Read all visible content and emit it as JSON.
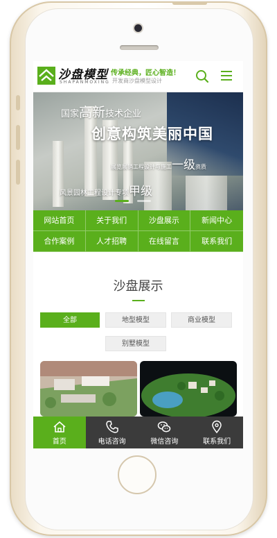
{
  "header": {
    "logo_text": "沙盘模型",
    "logo_sub": "SHAPANMOXING",
    "slogan": "传承经典，匠心智造！",
    "slogan_sub": "开发商沙盘模型设计"
  },
  "banner": {
    "line1_pre": "国家",
    "line1_big": "高新",
    "line1_post": "技术企业",
    "headline": "创意构筑美丽中国",
    "line3_pre": "展览展销工程设计与施工",
    "line3_big": "一级",
    "line3_post": "资质",
    "line4_pre": "风景园林工程设计专项",
    "line4_big": "甲级",
    "slide_count": 2,
    "active_slide": 1
  },
  "nav": {
    "items": [
      {
        "label": "网站首页"
      },
      {
        "label": "关于我们"
      },
      {
        "label": "沙盘展示"
      },
      {
        "label": "新闻中心"
      },
      {
        "label": "合作案例"
      },
      {
        "label": "人才招聘"
      },
      {
        "label": "在线留言"
      },
      {
        "label": "联系我们"
      }
    ]
  },
  "section": {
    "title": "沙盘展示"
  },
  "filters": {
    "items": [
      {
        "label": "全部",
        "active": true
      },
      {
        "label": "地型模型",
        "active": false
      },
      {
        "label": "商业模型",
        "active": false
      },
      {
        "label": "别墅模型",
        "active": false
      }
    ]
  },
  "bottom_bar": {
    "items": [
      {
        "label": "首页",
        "icon": "home-icon",
        "active": true
      },
      {
        "label": "电话咨询",
        "icon": "phone-icon",
        "active": false
      },
      {
        "label": "微信咨询",
        "icon": "wechat-icon",
        "active": false
      },
      {
        "label": "联系我们",
        "icon": "location-pin-icon",
        "active": false
      }
    ]
  },
  "colors": {
    "accent": "#5aaf1c",
    "bottom_bar_bg": "#3b3b3b",
    "frame_gold": "#d9c9aa"
  }
}
